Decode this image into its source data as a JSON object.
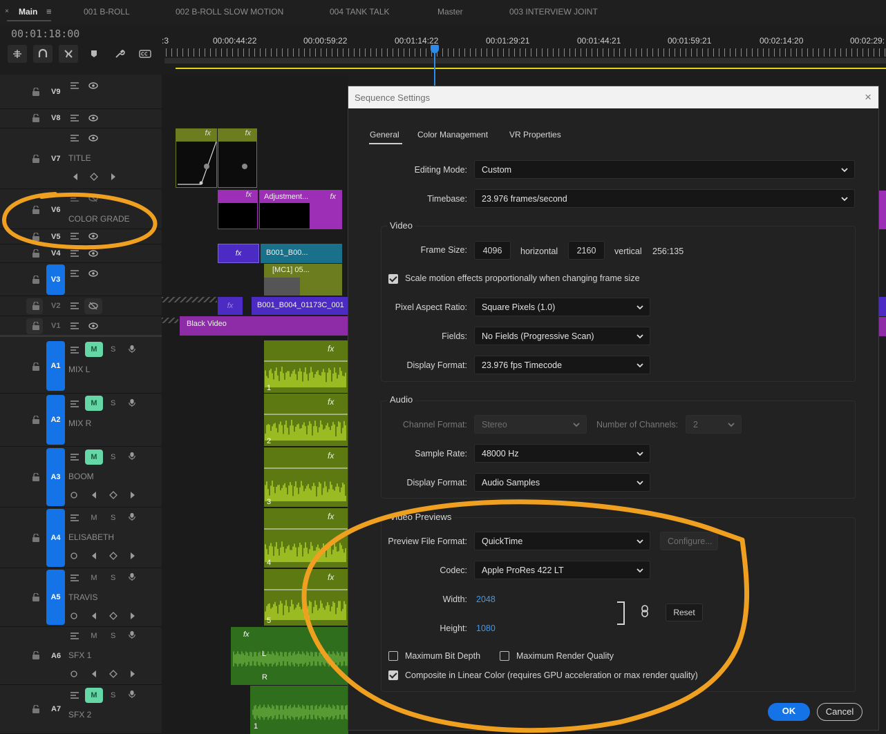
{
  "tabs": {
    "close_glyph": "×",
    "items": [
      "Main",
      "001 B-ROLL",
      "002 B-ROLL SLOW MOTION",
      "004 TANK TALK",
      "Master",
      "003 INTERVIEW JOINT"
    ],
    "menu_glyph": "≡"
  },
  "timecode": "00:01:18:00",
  "ruler": {
    "labels": [
      ":3",
      "00:00:44:22",
      "00:00:59:22",
      "00:01:14:22",
      "00:01:29:21",
      "00:01:44:21",
      "00:01:59:21",
      "00:02:14:20",
      "00:02:29:"
    ]
  },
  "tracks": {
    "video": [
      {
        "id": "V9",
        "name": ""
      },
      {
        "id": "V8",
        "name": ""
      },
      {
        "id": "V7",
        "name": "TITLE"
      },
      {
        "id": "V6",
        "name": "COLOR GRADE"
      },
      {
        "id": "V5",
        "name": ""
      },
      {
        "id": "V4",
        "name": ""
      },
      {
        "id": "V3",
        "name": ""
      },
      {
        "id": "V2",
        "name": ""
      },
      {
        "id": "V1",
        "name": ""
      }
    ],
    "audio": [
      {
        "id": "A1",
        "name": "MIX L",
        "mute": "M",
        "solo": "S"
      },
      {
        "id": "A2",
        "name": "MIX R",
        "mute": "M",
        "solo": "S"
      },
      {
        "id": "A3",
        "name": "BOOM",
        "mute": "M",
        "solo": "S"
      },
      {
        "id": "A4",
        "name": "ELISABETH",
        "mute": "M",
        "solo": "S"
      },
      {
        "id": "A5",
        "name": "TRAVIS",
        "mute": "M",
        "solo": "S"
      },
      {
        "id": "A6",
        "name": "SFX 1",
        "mute": "M",
        "solo": "S"
      },
      {
        "id": "A7",
        "name": "SFX 2",
        "mute": "M",
        "solo": "S"
      }
    ]
  },
  "clips": {
    "fx": "fx",
    "adjustment": "Adjustment...",
    "b001_short": "B001_B00...",
    "mc1": "[MC1] 05...",
    "b001_long": "B001_B004_01173C_001",
    "black_video": "Black Video",
    "audio_numbers": [
      "1",
      "2",
      "3",
      "4",
      "5"
    ],
    "sfx_l": "L",
    "sfx_r": "R",
    "sfx2_num": "1"
  },
  "dialog": {
    "title": "Sequence Settings",
    "close": "×",
    "tabs": [
      "General",
      "Color Management",
      "VR Properties"
    ],
    "editing_mode": {
      "label": "Editing Mode:",
      "value": "Custom"
    },
    "timebase": {
      "label": "Timebase:",
      "value": "23.976  frames/second"
    },
    "video": {
      "title": "Video",
      "frame_size_label": "Frame Size:",
      "width": "4096",
      "horizontal": "horizontal",
      "height": "2160",
      "vertical": "vertical",
      "ratio": "256:135",
      "scale_label": "Scale motion effects proportionally when changing frame size",
      "scale_checked": true,
      "par_label": "Pixel Aspect Ratio:",
      "par_value": "Square Pixels (1.0)",
      "fields_label": "Fields:",
      "fields_value": "No Fields (Progressive Scan)",
      "display_label": "Display Format:",
      "display_value": "23.976 fps Timecode"
    },
    "audio": {
      "title": "Audio",
      "channel_label": "Channel Format:",
      "channel_value": "Stereo",
      "num_channels_label": "Number of Channels:",
      "num_channels_value": "2",
      "sample_label": "Sample Rate:",
      "sample_value": "48000 Hz",
      "display_label": "Display Format:",
      "display_value": "Audio Samples"
    },
    "previews": {
      "title": "Video Previews",
      "format_label": "Preview File Format:",
      "format_value": "QuickTime",
      "configure": "Configure...",
      "codec_label": "Codec:",
      "codec_value": "Apple ProRes 422 LT",
      "width_label": "Width:",
      "width_value": "2048",
      "height_label": "Height:",
      "height_value": "1080",
      "reset": "Reset"
    },
    "max_bit_depth": "Maximum Bit Depth",
    "max_render_quality": "Maximum Render Quality",
    "composite_label": "Composite in Linear Color (requires GPU acceleration or max render quality)",
    "composite_checked": true,
    "ok": "OK",
    "cancel": "Cancel"
  },
  "colors": {
    "accent_blue": "#1473e6",
    "annotation_orange": "#f0a020",
    "audio_clip": "#9bc01e",
    "adjustment_purple": "#9c2fb5",
    "title_clip": "#6b7d1f"
  }
}
